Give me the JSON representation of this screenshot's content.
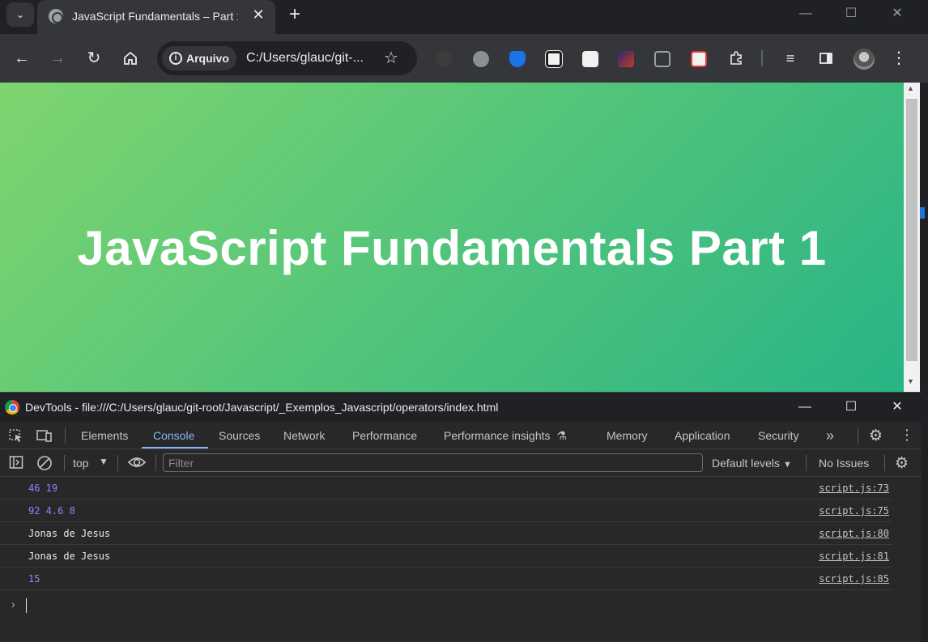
{
  "browser": {
    "tab": {
      "title": "JavaScript Fundamentals – Part 1"
    },
    "new_tab_symbol": "+",
    "omnibox": {
      "security_label": "Arquivo",
      "url": "C:/Users/glauc/git-..."
    },
    "icons": {
      "back": "arrow-left-icon",
      "forward": "arrow-right-icon",
      "reload": "reload-icon",
      "home": "home-icon",
      "bookmark": "star-icon",
      "extensions": "puzzle-icon",
      "side_panel": "side-panel-icon",
      "menu": "kebab-menu-icon"
    }
  },
  "page": {
    "heading": "JavaScript Fundamentals Part 1",
    "gradient_start": "#7ed56f",
    "gradient_end": "#28b485"
  },
  "devtools": {
    "title": "DevTools - file:///C:/Users/glauc/git-root/Javascript/_Exemplos_Javascript/operators/index.html",
    "tabs": [
      "Elements",
      "Console",
      "Sources",
      "Network",
      "Performance",
      "Performance insights",
      "Memory",
      "Application",
      "Security"
    ],
    "active_tab": "Console",
    "console_toolbar": {
      "context": "top",
      "filter_placeholder": "Filter",
      "levels": "Default levels",
      "issues": "No Issues"
    },
    "logs": [
      {
        "message": "46 19",
        "kind": "number",
        "source": "script.js:73"
      },
      {
        "message": "92 4.6 8",
        "kind": "number",
        "source": "script.js:75"
      },
      {
        "message": "Jonas de Jesus",
        "kind": "string",
        "source": "script.js:80"
      },
      {
        "message": "Jonas de Jesus",
        "kind": "string",
        "source": "script.js:81"
      },
      {
        "message": "15",
        "kind": "number",
        "source": "script.js:85"
      }
    ],
    "colors": {
      "accent": "#8ab4f8",
      "number": "#9980ff"
    }
  }
}
